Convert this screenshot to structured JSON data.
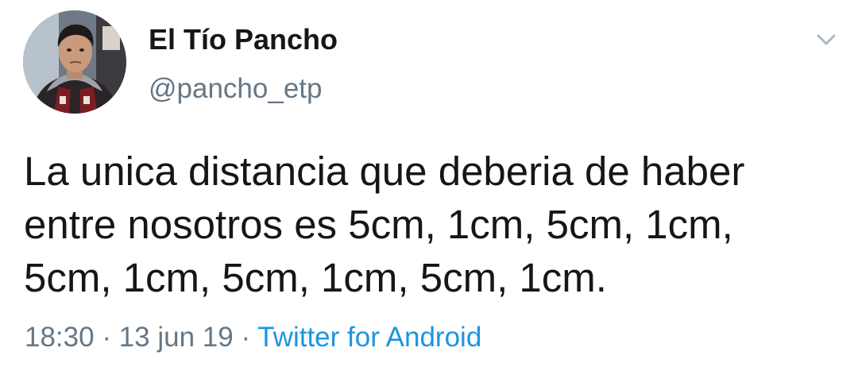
{
  "user": {
    "display_name": "El Tío Pancho",
    "handle": "@pancho_etp"
  },
  "tweet": {
    "text_lines": [
      "La unica distancia que deberia de haber",
      "entre nosotros es 5cm, 1cm, 5cm, 1cm,",
      "5cm, 1cm, 5cm, 1cm, 5cm, 1cm."
    ]
  },
  "meta": {
    "time": "18:30",
    "sep1": " · ",
    "date": "13 jun 19",
    "sep2": " · ",
    "source": "Twitter for Android"
  },
  "icons": {
    "menu": "chevron-down-icon"
  },
  "colors": {
    "text": "#14171a",
    "secondary": "#657786",
    "link": "#1b95e0",
    "background": "#ffffff"
  }
}
